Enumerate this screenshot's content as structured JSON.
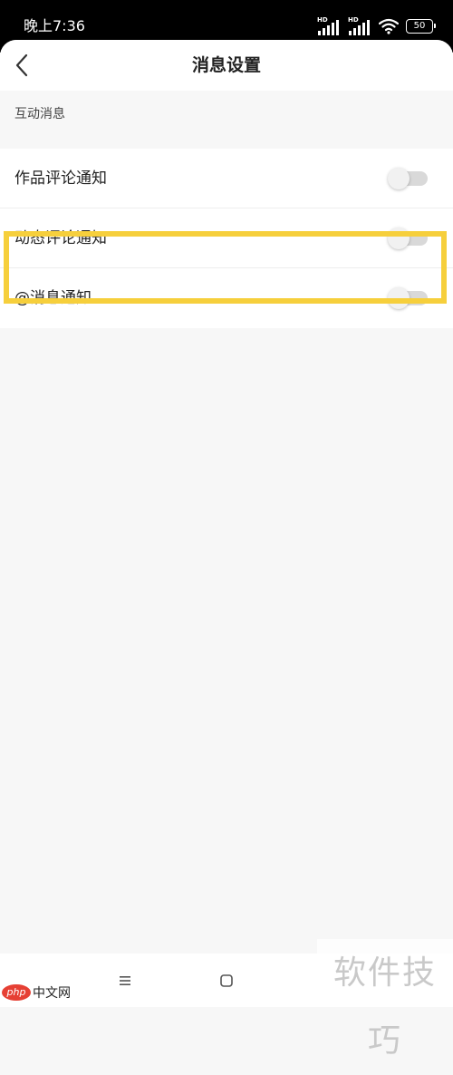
{
  "status_bar": {
    "time": "晚上7:36",
    "signal_1_label": "HD",
    "signal_2_label": "HD",
    "battery": "50",
    "icons": [
      "signal-icon",
      "signal-icon",
      "wifi-icon",
      "battery-icon"
    ]
  },
  "nav": {
    "back_icon": "chevron-left-icon",
    "title": "消息设置"
  },
  "section": {
    "header": "互动消息"
  },
  "settings": [
    {
      "label": "作品评论通知",
      "enabled": false
    },
    {
      "label": "动态评论通知",
      "enabled": false
    },
    {
      "label": "@消息通知",
      "enabled": false
    }
  ],
  "system_nav": {
    "icons": [
      "menu-icon",
      "home-icon"
    ]
  },
  "watermarks": {
    "php_badge": "php",
    "php_site": "中文网",
    "skill": "软件技巧"
  },
  "colors": {
    "highlight": "#f6cf3c",
    "toggle_off_track": "#d9d9d9",
    "status_bar": "#000000"
  }
}
